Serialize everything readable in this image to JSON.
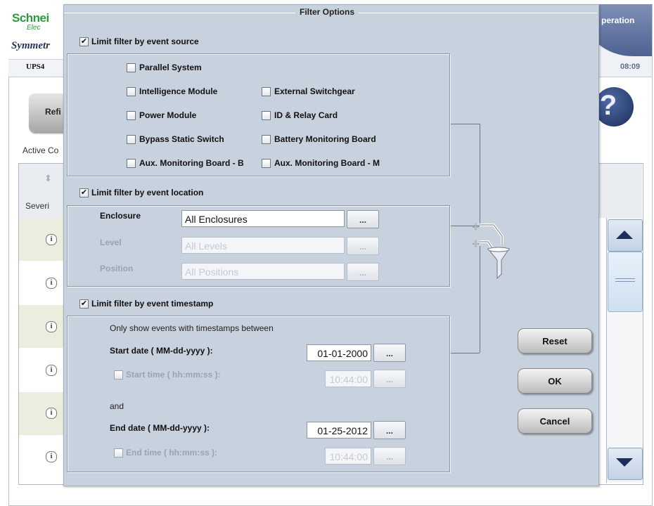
{
  "app": {
    "brand": "Schnei",
    "brand_sub": "Elec",
    "product": "Symmetr",
    "device": "UPS4",
    "mode_tab": "peration",
    "time": "08:09",
    "refresh_label": "Refi",
    "help_glyph": "?",
    "active_label": "Active Co",
    "severity_header": "Severi",
    "row_icon": "i"
  },
  "dialog": {
    "title": "Filter Options",
    "source": {
      "label": "Limit filter by event source",
      "checked": "✔",
      "items": [
        {
          "label": "Parallel System",
          "checked": ""
        },
        {
          "label": "Intelligence Module",
          "checked": ""
        },
        {
          "label": "External Switchgear",
          "checked": ""
        },
        {
          "label": "Power Module",
          "checked": ""
        },
        {
          "label": "ID & Relay Card",
          "checked": ""
        },
        {
          "label": "Bypass Static Switch",
          "checked": ""
        },
        {
          "label": "Battery Monitoring Board",
          "checked": ""
        },
        {
          "label": "Aux. Monitoring Board - B",
          "checked": ""
        },
        {
          "label": "Aux. Monitoring Board - M",
          "checked": ""
        }
      ]
    },
    "location": {
      "label": "Limit filter by event location",
      "checked": "✔",
      "enclosure_label": "Enclosure",
      "enclosure_value": "All Enclosures",
      "level_label": "Level",
      "level_value": "All Levels",
      "position_label": "Position",
      "position_value": "All Positions",
      "browse": "..."
    },
    "timestamp": {
      "label": "Limit filter by event timestamp",
      "checked": "✔",
      "intro": "Only show events with timestamps between",
      "start_date_label": "Start date ( MM-dd-yyyy ):",
      "start_date_value": "01-01-2000",
      "start_time_label": "Start time ( hh:mm:ss ):",
      "start_time_value": "10:44:00",
      "and": "and",
      "end_date_label": "End date ( MM-dd-yyyy ):",
      "end_date_value": "01-25-2012",
      "end_time_label": "End time ( hh:mm:ss ):",
      "end_time_value": "10:44:00",
      "browse": "..."
    },
    "buttons": {
      "reset": "Reset",
      "ok": "OK",
      "cancel": "Cancel"
    }
  }
}
